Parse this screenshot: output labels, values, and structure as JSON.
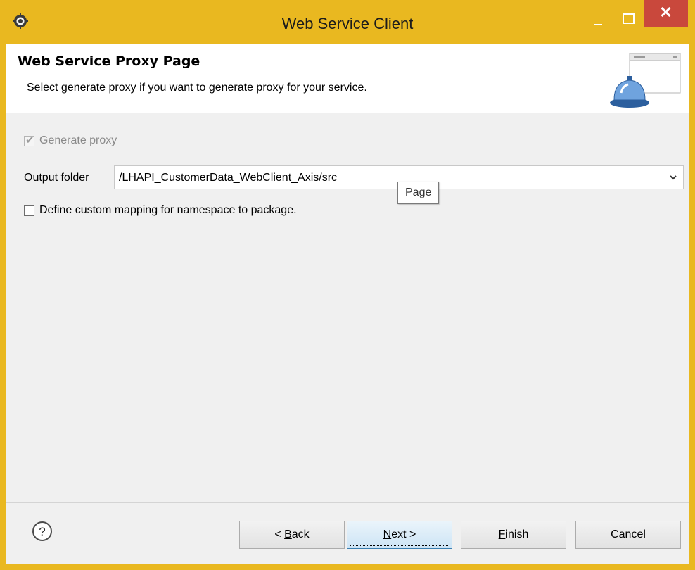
{
  "window": {
    "title": "Web Service Client",
    "close_label": "✕"
  },
  "header": {
    "title": "Web Service Proxy Page",
    "description": "Select generate proxy if you want to generate proxy for your service."
  },
  "form": {
    "generate_proxy": {
      "label": "Generate proxy",
      "checked": true,
      "enabled": false
    },
    "output_folder": {
      "label": "Output folder",
      "value": "/LHAPI_CustomerData_WebClient_Axis/src"
    },
    "custom_mapping": {
      "label": "Define custom mapping for namespace to package.",
      "checked": false
    }
  },
  "tooltip": {
    "text": "Page"
  },
  "buttons": {
    "back": {
      "pre": "< ",
      "mnemonic": "B",
      "post": "ack"
    },
    "next": {
      "pre": "",
      "mnemonic": "N",
      "post": "ext >"
    },
    "finish": {
      "pre": "",
      "mnemonic": "F",
      "post": "inish"
    },
    "cancel": {
      "pre": "",
      "mnemonic": "",
      "post": "Cancel"
    }
  },
  "colors": {
    "titlebar": "#e9b820",
    "close_button": "#c9483c",
    "client_bg": "#f0f0f0",
    "default_button_border": "#3c7fb1"
  },
  "icons": {
    "app": "eclipse-gear-icon",
    "help": "question-circle-icon",
    "wizard_banner": "service-bell-window-icon",
    "dropdown": "chevron-down-icon"
  }
}
